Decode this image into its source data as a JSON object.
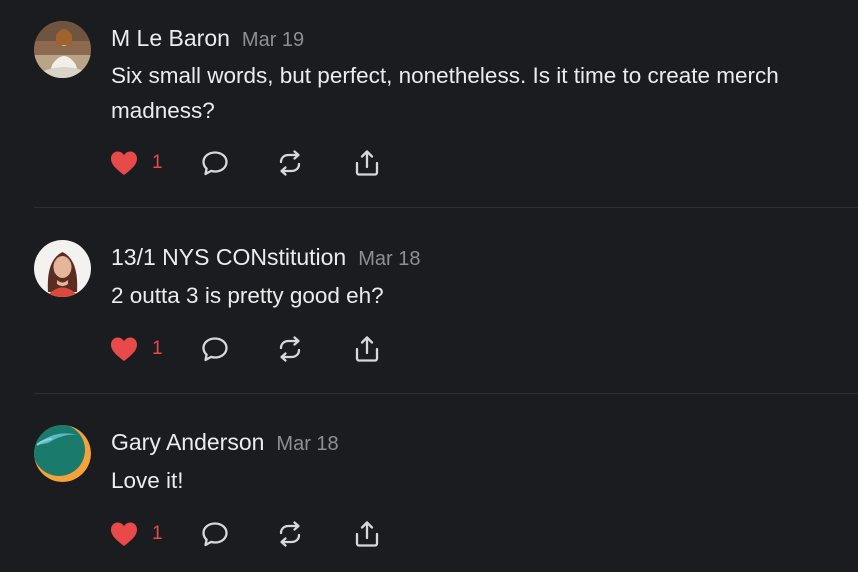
{
  "comments": [
    {
      "author": "M Le Baron",
      "date": "Mar 19",
      "text": "Six small words, but perfect, nonetheless. Is it time to create merch madness?",
      "likes": "1"
    },
    {
      "author": "13/1 NYS CONstitution",
      "date": "Mar 18",
      "text": "2 outta 3 is pretty good eh?",
      "likes": "1"
    },
    {
      "author": "Gary Anderson",
      "date": "Mar 18",
      "text": "Love it!",
      "likes": "1"
    }
  ],
  "colors": {
    "background": "#1b1c1f",
    "heart": "#e84a4a",
    "icon": "#d8d8dc",
    "date": "#8e8f94",
    "divider": "#2e2f33"
  },
  "icons": [
    "heart-icon",
    "reply-bubble-icon",
    "repost-icon",
    "share-icon"
  ]
}
